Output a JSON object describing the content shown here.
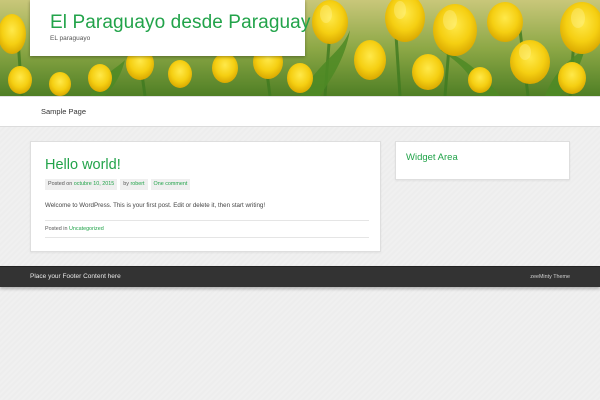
{
  "header": {
    "site_title": "El Paraguayo desde Paraguay",
    "tagline": "EL paraguayo",
    "banner_image": "yellow-tulips-banner"
  },
  "nav": {
    "items": [
      {
        "label": "Sample Page"
      }
    ]
  },
  "post": {
    "title": "Hello world!",
    "meta": {
      "posted_on_label": "Posted on",
      "date": "octubre 10, 2015",
      "by_label": "by",
      "author": "robert",
      "comments": "One comment"
    },
    "content": "Welcome to WordPress. This is your first post. Edit or delete it, then start writing!",
    "category_label": "Posted in",
    "category": "Uncategorized"
  },
  "sidebar": {
    "widget_title": "Widget Area"
  },
  "footer": {
    "left_text": "Place your Footer Content here",
    "credit": "zeeMinty Theme"
  },
  "colors": {
    "accent": "#22a34a",
    "footer_bg": "#333333",
    "page_bg": "#f0f0f0"
  }
}
